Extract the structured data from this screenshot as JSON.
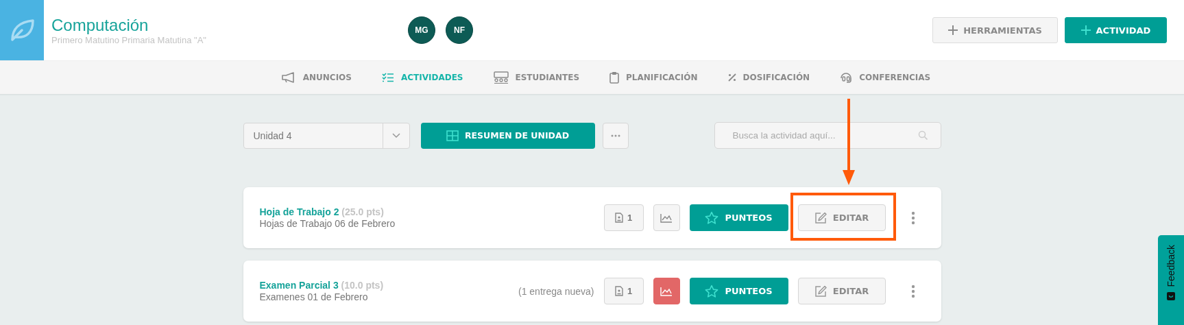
{
  "course": {
    "title": "Computación",
    "subtitle": "Primero Matutino Primaria Matutina \"A\""
  },
  "avatars": [
    {
      "initials": "MG"
    },
    {
      "initials": "NF"
    }
  ],
  "header_buttons": [
    {
      "label": "HERRAMIENTAS",
      "kind": "secondary"
    },
    {
      "label": "ACTIVIDAD",
      "kind": "primary"
    }
  ],
  "nav": [
    {
      "label": "ANUNCIOS",
      "selected": false
    },
    {
      "label": "ACTIVIDADES",
      "selected": true
    },
    {
      "label": "ESTUDIANTES",
      "selected": false
    },
    {
      "label": "PLANIFICACIÓN",
      "selected": false
    },
    {
      "label": "DOSIFICACIÓN",
      "selected": false
    },
    {
      "label": "CONFERENCIAS",
      "selected": false
    }
  ],
  "toolbar": {
    "unit": "Unidad 4",
    "summary_button": "RESUMEN DE UNIDAD",
    "search": {
      "placeholder": "Busca la actividad aquí..."
    }
  },
  "activities": [
    {
      "title": "Hoja de Trabajo 2",
      "points": "(25.0 pts)",
      "subtitle": "Hojas de Trabajo 06 de Febrero",
      "submissions": "1",
      "chart_alert": false,
      "scores_button": "PUNTEOS",
      "edit_button": "EDITAR",
      "highlighted": true
    },
    {
      "title": "Examen Parcial 3",
      "points": "(10.0 pts)",
      "subtitle": "Examenes 01 de Febrero",
      "new_note": "(1 entrega nueva)",
      "submissions": "1",
      "chart_alert": true,
      "scores_button": "PUNTEOS",
      "edit_button": "EDITAR",
      "highlighted": false
    }
  ],
  "feedback_tab": "Feedback"
}
